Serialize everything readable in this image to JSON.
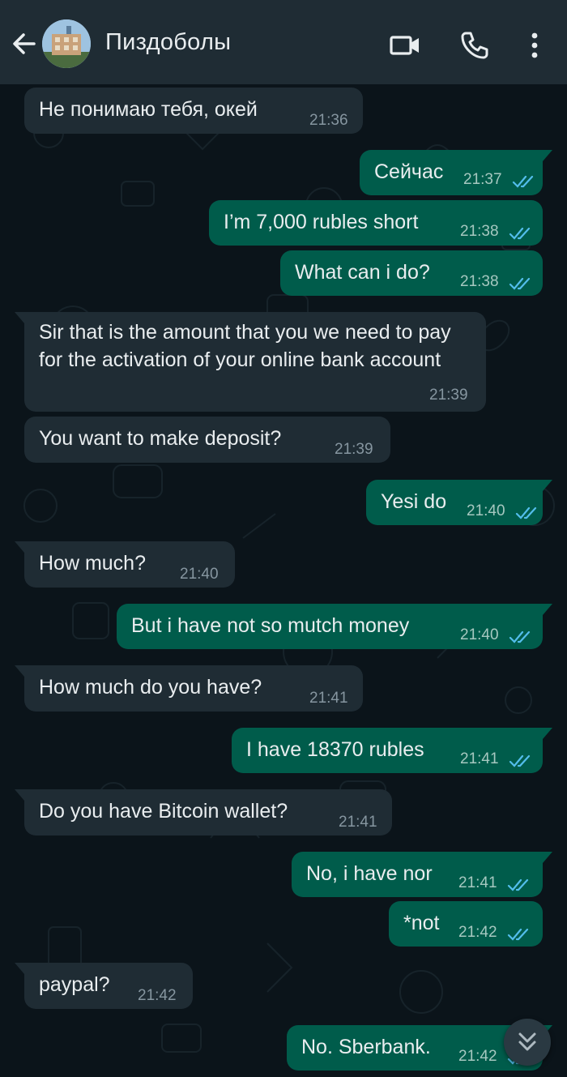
{
  "header": {
    "title": "Пиздоболы"
  },
  "colors": {
    "header_bg": "#1f2c34",
    "chat_bg": "#0b141a",
    "incoming_bubble": "#1f2c34",
    "outgoing_bubble": "#005c4b",
    "read_ticks": "#53bdeb"
  },
  "messages": [
    {
      "dir": "in",
      "text": "Не понимаю тебя, окей",
      "time": "21:36"
    },
    {
      "dir": "out",
      "text": "Сейчас",
      "time": "21:37",
      "status": "read"
    },
    {
      "dir": "out",
      "text": "I’m 7,000 rubles short",
      "time": "21:38",
      "status": "read"
    },
    {
      "dir": "out",
      "text": "What can i do?",
      "time": "21:38",
      "status": "read"
    },
    {
      "dir": "in",
      "text": "Sir that is the amount that you we need to pay for the activation of your online bank account",
      "time": "21:39"
    },
    {
      "dir": "in",
      "text": "You want to make deposit?",
      "time": "21:39"
    },
    {
      "dir": "out",
      "text": "Yesi do",
      "time": "21:40",
      "status": "read"
    },
    {
      "dir": "in",
      "text": "How much?",
      "time": "21:40"
    },
    {
      "dir": "out",
      "text": "But i have not so mutch money",
      "time": "21:40",
      "status": "read"
    },
    {
      "dir": "in",
      "text": "How much do you have?",
      "time": "21:41"
    },
    {
      "dir": "out",
      "text": "I have 18370 rubles",
      "time": "21:41",
      "status": "read"
    },
    {
      "dir": "in",
      "text": "Do you have Bitcoin wallet?",
      "time": "21:41"
    },
    {
      "dir": "out",
      "text": "No, i have nor",
      "time": "21:41",
      "status": "read"
    },
    {
      "dir": "out",
      "text": "*not",
      "time": "21:42",
      "status": "read"
    },
    {
      "dir": "in",
      "text": "paypal?",
      "time": "21:42"
    },
    {
      "dir": "out",
      "text": "No. Sberbank.",
      "time": "21:42",
      "status": "read"
    }
  ],
  "icons": [
    "back-arrow-icon",
    "group-avatar",
    "video-call-icon",
    "phone-icon",
    "more-vert-icon",
    "double-chevron-down-icon",
    "double-check-icon"
  ]
}
